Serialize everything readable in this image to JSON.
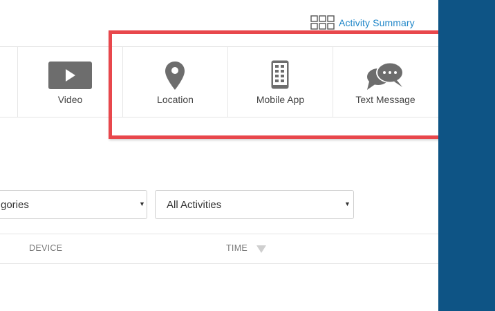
{
  "header": {
    "activity_summary_label": "Activity Summary"
  },
  "activity_types": [
    {
      "label": "Video",
      "icon": "video-play-icon"
    },
    {
      "label": "Location",
      "icon": "location-pin-icon"
    },
    {
      "label": "Mobile App",
      "icon": "mobile-phone-icon"
    },
    {
      "label": "Text Message",
      "icon": "chat-bubbles-icon"
    }
  ],
  "filters": {
    "categories_value": "gories",
    "activities_value": "All Activities"
  },
  "table": {
    "columns": [
      "DEVICE",
      "TIME"
    ]
  },
  "colors": {
    "highlight": "#e8474c",
    "link": "#1f86c8",
    "side_panel": "#0e5485",
    "icon": "#6d6d6d"
  }
}
